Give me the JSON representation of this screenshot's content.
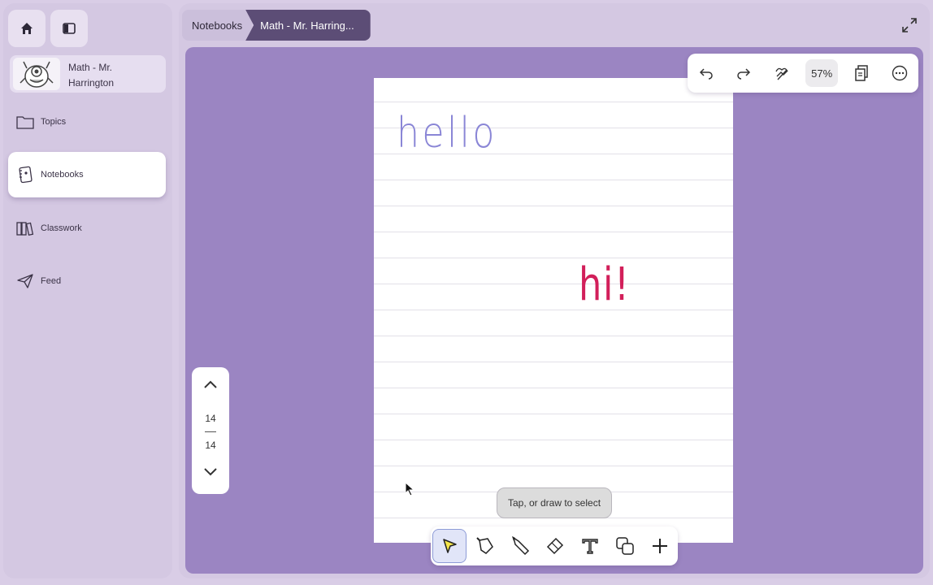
{
  "sidebar": {
    "class_name": "Math - Mr. Harrington",
    "nav": [
      {
        "label": "Topics",
        "icon": "folder-icon"
      },
      {
        "label": "Notebooks",
        "icon": "notebook-icon",
        "active": true
      },
      {
        "label": "Classwork",
        "icon": "books-icon"
      },
      {
        "label": "Feed",
        "icon": "paper-plane-icon"
      }
    ]
  },
  "breadcrumb": {
    "root": "Notebooks",
    "current": "Math - Mr. Harring..."
  },
  "toolbar": {
    "zoom": "57%",
    "buttons": [
      "undo-icon",
      "redo-icon",
      "lasso-icon",
      "zoom-level",
      "pages-icon",
      "more-icon"
    ]
  },
  "page_content": {
    "text1": "hello",
    "text1_color": "#8a86d6",
    "text2": "hi!",
    "text2_color": "#d21f5a"
  },
  "pager": {
    "current": "14",
    "total": "14"
  },
  "tooltip": "Tap, or draw to select",
  "drawing_tools": [
    "select-tool-icon",
    "pen-icon",
    "highlighter-icon",
    "eraser-icon",
    "text-tool-icon",
    "shapes-icon",
    "add-icon"
  ],
  "colors": {
    "canvas": "#9b85c2",
    "breadcrumb_active": "#5c4d76",
    "sidebar": "#d4c8e2"
  }
}
